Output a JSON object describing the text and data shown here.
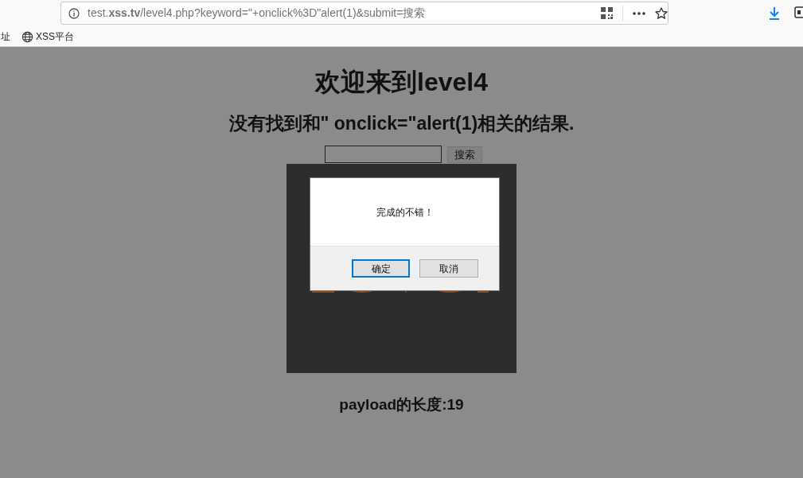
{
  "browser": {
    "url": "test.**xss.tv**/level4.php?keyword=\"+onclick%3D\"alert(1)&submit=搜索",
    "bookmarks": [
      {
        "label": "址",
        "kind": "plain"
      },
      {
        "label": "XSS平台",
        "kind": "globe"
      }
    ]
  },
  "page": {
    "title": "欢迎来到level4",
    "message": "没有找到和\" onclick=\"alert(1)相关的结果.",
    "search": {
      "button": "搜索"
    },
    "payload_length": "payload的长度:19"
  },
  "dialog": {
    "message": "完成的不错！",
    "buttons": [
      {
        "label": "确定",
        "focused": true
      },
      {
        "label": "取消",
        "focused": false
      }
    ]
  }
}
